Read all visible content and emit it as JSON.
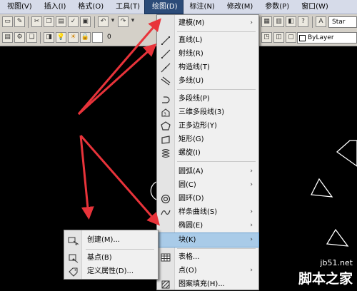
{
  "menubar": {
    "items": [
      {
        "label": "视图(V)"
      },
      {
        "label": "插入(I)"
      },
      {
        "label": "格式(O)"
      },
      {
        "label": "工具(T)"
      },
      {
        "label": "绘图(D)"
      },
      {
        "label": "标注(N)"
      },
      {
        "label": "修改(M)"
      },
      {
        "label": "参数(P)"
      },
      {
        "label": "窗口(W)"
      }
    ]
  },
  "toolbar": {
    "search_value": "Star",
    "layer_name": "0",
    "linetype": "ByLayer"
  },
  "draw_menu": {
    "items": [
      {
        "label": "建模(M)",
        "icon": "none"
      },
      {
        "label": "直线(L)",
        "icon": "line-icon"
      },
      {
        "label": "射线(R)",
        "icon": "ray-icon"
      },
      {
        "label": "构造线(T)",
        "icon": "construction-line-icon"
      },
      {
        "label": "多线(U)",
        "icon": "multiline-icon"
      },
      {
        "label": "多段线(P)",
        "icon": "polyline-icon"
      },
      {
        "label": "三维多段线(3)",
        "icon": "3d-polyline-icon"
      },
      {
        "label": "正多边形(Y)",
        "icon": "polygon-icon"
      },
      {
        "label": "矩形(G)",
        "icon": "rectangle-icon"
      },
      {
        "label": "螺旋(I)",
        "icon": "helix-icon"
      },
      {
        "label": "圆弧(A)",
        "icon": "none"
      },
      {
        "label": "圆(C)",
        "icon": "none"
      },
      {
        "label": "圆环(D)",
        "icon": "donut-icon"
      },
      {
        "label": "样条曲线(S)",
        "icon": "spline-icon"
      },
      {
        "label": "椭圆(E)",
        "icon": "none"
      },
      {
        "label": "块(K)",
        "icon": "none"
      },
      {
        "label": "表格...",
        "icon": "table-icon"
      },
      {
        "label": "点(O)",
        "icon": "none"
      },
      {
        "label": "图案填充(H)...",
        "icon": "hatch-icon"
      }
    ],
    "submenu_arrow": "›"
  },
  "block_submenu": {
    "items": [
      {
        "label": "创建(M)...",
        "icon": "create-block-icon"
      },
      {
        "label": "基点(B)",
        "icon": "base-point-icon"
      },
      {
        "label": "定义属性(D)...",
        "icon": "define-attribute-icon"
      }
    ]
  },
  "watermark": {
    "url": "jb51.net",
    "brand": "脚本之家"
  },
  "colors": {
    "menubar_bg": "#d6dbe9",
    "active_menu_bg": "#2b4b78",
    "menu_bg": "#f0f0f0",
    "highlight_bg": "#a9cbe8",
    "canvas_bg": "#000000",
    "annotation_arrow": "#e8333a"
  }
}
